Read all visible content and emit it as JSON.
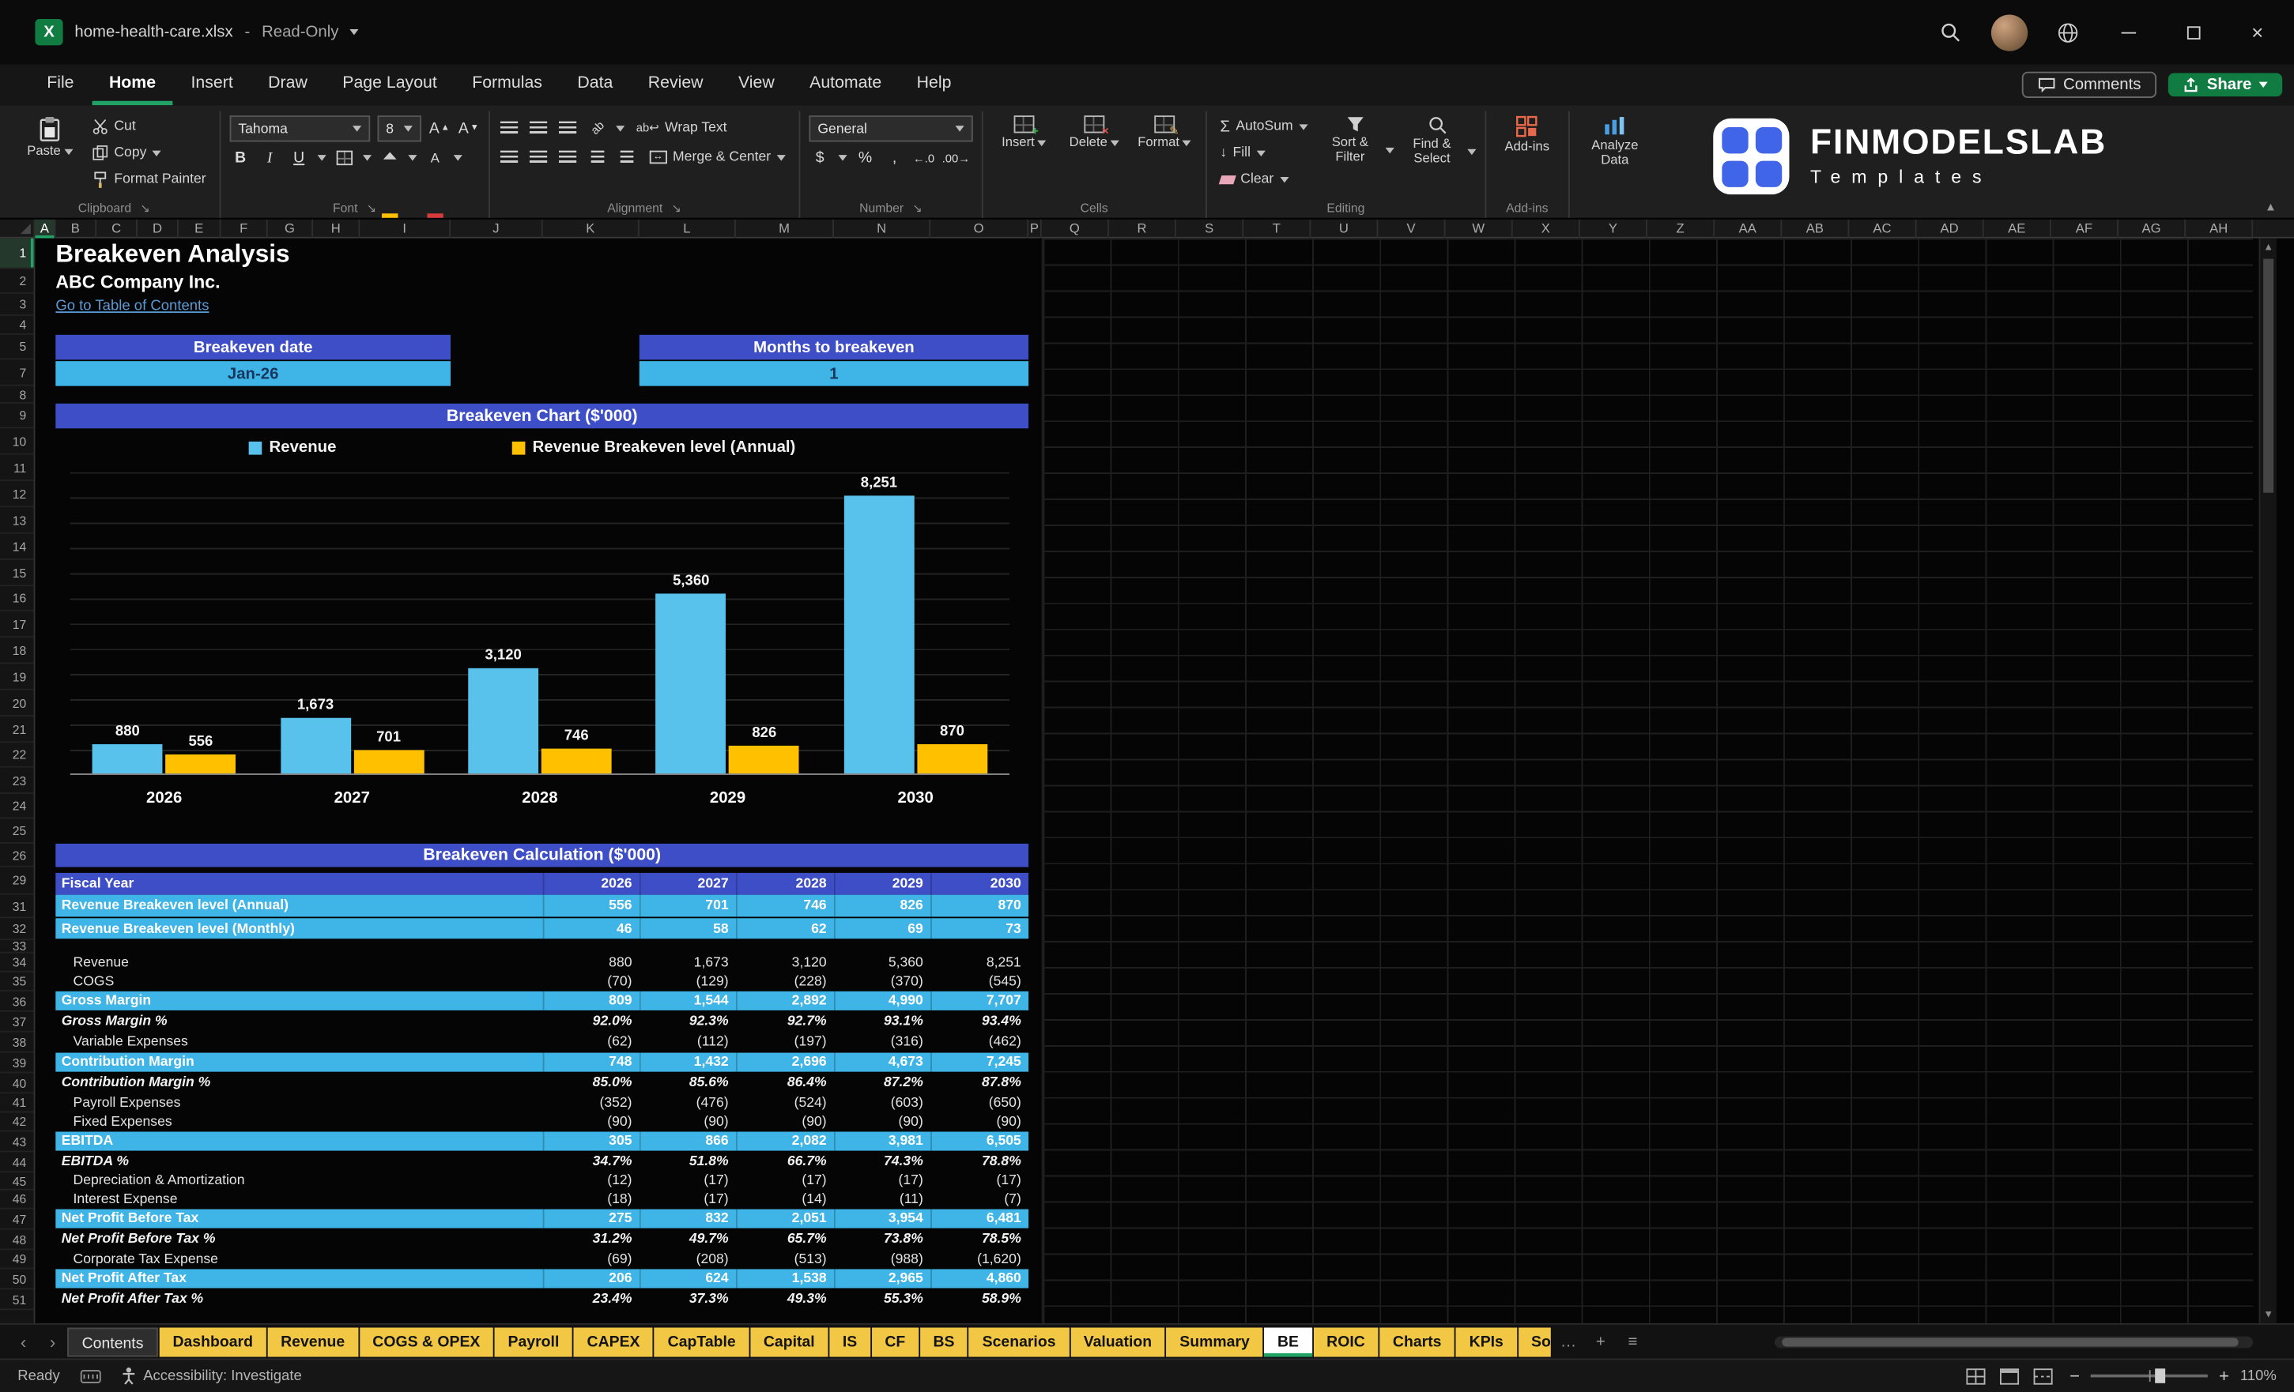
{
  "titlebar": {
    "filename": "home-health-care.xlsx",
    "separator": "-",
    "mode": "Read-Only"
  },
  "menubar": {
    "tabs": [
      "File",
      "Home",
      "Insert",
      "Draw",
      "Page Layout",
      "Formulas",
      "Data",
      "Review",
      "View",
      "Automate",
      "Help"
    ],
    "active_tab": "Home",
    "comments_label": "Comments",
    "share_label": "Share"
  },
  "ribbon": {
    "clipboard": {
      "label": "Clipboard",
      "paste": "Paste",
      "cut": "Cut",
      "copy": "Copy",
      "format_painter": "Format Painter"
    },
    "font": {
      "label": "Font",
      "font_name": "Tahoma",
      "font_size": "8"
    },
    "alignment": {
      "label": "Alignment",
      "wrap_text": "Wrap Text",
      "merge_center": "Merge & Center"
    },
    "number": {
      "label": "Number",
      "format": "General"
    },
    "cells": {
      "label": "Cells",
      "insert": "Insert",
      "delete": "Delete",
      "format": "Format"
    },
    "editing": {
      "label": "Editing",
      "autosum": "AutoSum",
      "fill": "Fill",
      "clear": "Clear",
      "sort_filter": "Sort & Filter",
      "find_select": "Find & Select"
    },
    "addins": {
      "label": "Add-ins",
      "addins": "Add-ins",
      "analyze": "Analyze Data"
    },
    "logo": {
      "brand": "FINMODELSLAB",
      "sub": "Templates"
    }
  },
  "grid": {
    "title": "Breakeven Analysis",
    "company": "ABC Company Inc.",
    "link": "Go to Table of Contents",
    "breakeven_date_label": "Breakeven date",
    "breakeven_date_value": "Jan-26",
    "months_label": "Months to breakeven",
    "months_value": "1",
    "columns": [
      {
        "label": "A",
        "w": 14
      },
      {
        "label": "B",
        "w": 28
      },
      {
        "label": "C",
        "w": 28
      },
      {
        "label": "D",
        "w": 28
      },
      {
        "label": "E",
        "w": 29
      },
      {
        "label": "F",
        "w": 32
      },
      {
        "label": "G",
        "w": 31
      },
      {
        "label": "H",
        "w": 32
      },
      {
        "label": "I",
        "w": 62
      },
      {
        "label": "J",
        "w": 63
      },
      {
        "label": "K",
        "w": 66
      },
      {
        "label": "L",
        "w": 66
      },
      {
        "label": "M",
        "w": 67
      },
      {
        "label": "N",
        "w": 66
      },
      {
        "label": "O",
        "w": 67
      },
      {
        "label": "P",
        "w": 9
      },
      {
        "label": "Q",
        "w": 46
      },
      {
        "label": "R",
        "w": 46
      },
      {
        "label": "S",
        "w": 46
      },
      {
        "label": "T",
        "w": 46
      },
      {
        "label": "U",
        "w": 46
      },
      {
        "label": "V",
        "w": 46
      },
      {
        "label": "W",
        "w": 46
      },
      {
        "label": "X",
        "w": 46
      },
      {
        "label": "Y",
        "w": 46
      },
      {
        "label": "Z",
        "w": 46
      },
      {
        "label": "AA",
        "w": 46
      },
      {
        "label": "AB",
        "w": 46
      },
      {
        "label": "AC",
        "w": 46
      },
      {
        "label": "AD",
        "w": 46
      },
      {
        "label": "AE",
        "w": 46
      },
      {
        "label": "AF",
        "w": 46
      },
      {
        "label": "AG",
        "w": 46
      },
      {
        "label": "AH",
        "w": 46
      }
    ],
    "rows": [
      {
        "n": 1,
        "y": 0,
        "h": 21
      },
      {
        "n": 2,
        "y": 21,
        "h": 17
      },
      {
        "n": 3,
        "y": 38,
        "h": 15
      },
      {
        "n": 4,
        "y": 53,
        "h": 13
      },
      {
        "n": 5,
        "y": 66,
        "h": 17
      },
      {
        "n": 7,
        "y": 83,
        "h": 18
      },
      {
        "n": 8,
        "y": 101,
        "h": 12
      },
      {
        "n": 9,
        "y": 113,
        "h": 17
      },
      {
        "n": 10,
        "y": 130,
        "h": 18
      },
      {
        "n": 11,
        "y": 148,
        "h": 18
      },
      {
        "n": 12,
        "y": 166,
        "h": 18
      },
      {
        "n": 13,
        "y": 184,
        "h": 18
      },
      {
        "n": 14,
        "y": 202,
        "h": 18
      },
      {
        "n": 15,
        "y": 220,
        "h": 18
      },
      {
        "n": 16,
        "y": 238,
        "h": 17
      },
      {
        "n": 17,
        "y": 255,
        "h": 18
      },
      {
        "n": 18,
        "y": 273,
        "h": 18
      },
      {
        "n": 19,
        "y": 291,
        "h": 18
      },
      {
        "n": 20,
        "y": 309,
        "h": 18
      },
      {
        "n": 21,
        "y": 327,
        "h": 18
      },
      {
        "n": 22,
        "y": 345,
        "h": 17
      },
      {
        "n": 23,
        "y": 362,
        "h": 18
      },
      {
        "n": 24,
        "y": 380,
        "h": 17
      },
      {
        "n": 25,
        "y": 397,
        "h": 17
      },
      {
        "n": 26,
        "y": 414,
        "h": 16
      },
      {
        "n": 29,
        "y": 430,
        "h": 19
      },
      {
        "n": 31,
        "y": 449,
        "h": 16
      },
      {
        "n": 32,
        "y": 465,
        "h": 15
      },
      {
        "n": 33,
        "y": 480,
        "h": 9
      },
      {
        "n": 34,
        "y": 489,
        "h": 13
      },
      {
        "n": 35,
        "y": 502,
        "h": 13
      },
      {
        "n": 36,
        "y": 515,
        "h": 14
      },
      {
        "n": 37,
        "y": 529,
        "h": 14
      },
      {
        "n": 38,
        "y": 543,
        "h": 14
      },
      {
        "n": 39,
        "y": 557,
        "h": 14
      },
      {
        "n": 40,
        "y": 571,
        "h": 14
      },
      {
        "n": 41,
        "y": 585,
        "h": 13
      },
      {
        "n": 42,
        "y": 598,
        "h": 13
      },
      {
        "n": 43,
        "y": 611,
        "h": 14
      },
      {
        "n": 44,
        "y": 625,
        "h": 14
      },
      {
        "n": 45,
        "y": 639,
        "h": 12
      },
      {
        "n": 46,
        "y": 651,
        "h": 13
      },
      {
        "n": 47,
        "y": 664,
        "h": 14
      },
      {
        "n": 48,
        "y": 678,
        "h": 14
      },
      {
        "n": 49,
        "y": 692,
        "h": 13
      },
      {
        "n": 50,
        "y": 705,
        "h": 14
      },
      {
        "n": 51,
        "y": 719,
        "h": 14
      }
    ]
  },
  "chart_data": {
    "type": "bar",
    "title": "Breakeven Chart ($'000)",
    "categories": [
      "2026",
      "2027",
      "2028",
      "2029",
      "2030"
    ],
    "series": [
      {
        "name": "Revenue",
        "color": "#58C1EC",
        "values": [
          880,
          1673,
          3120,
          5360,
          8251
        ],
        "labels": [
          "880",
          "1,673",
          "3,120",
          "5,360",
          "8,251"
        ]
      },
      {
        "name": "Revenue Breakeven level (Annual)",
        "color": "#FFC000",
        "values": [
          556,
          701,
          746,
          826,
          870
        ],
        "labels": [
          "556",
          "701",
          "746",
          "826",
          "870"
        ]
      }
    ],
    "ylim": [
      0,
      9000
    ],
    "legend_position": "top",
    "grid": true
  },
  "table": {
    "title": "Breakeven Calculation ($'000)",
    "header": {
      "label": "Fiscal Year",
      "years": [
        "2026",
        "2027",
        "2028",
        "2029",
        "2030"
      ]
    },
    "rows": [
      {
        "label": "Revenue Breakeven level (Annual)",
        "type": "highlight",
        "values": [
          "556",
          "701",
          "746",
          "826",
          "870"
        ]
      },
      {
        "label": "Revenue Breakeven level (Monthly)",
        "type": "highlight",
        "values": [
          "46",
          "58",
          "62",
          "69",
          "73"
        ]
      },
      {
        "label": "",
        "type": "gap",
        "values": [
          "",
          "",
          "",
          "",
          ""
        ]
      },
      {
        "label": "Revenue",
        "type": "plain",
        "values": [
          "880",
          "1,673",
          "3,120",
          "5,360",
          "8,251"
        ]
      },
      {
        "label": "COGS",
        "type": "plain",
        "values": [
          "(70)",
          "(129)",
          "(228)",
          "(370)",
          "(545)"
        ]
      },
      {
        "label": "Gross Margin",
        "type": "highlight",
        "values": [
          "809",
          "1,544",
          "2,892",
          "4,990",
          "7,707"
        ]
      },
      {
        "label": "Gross Margin %",
        "type": "pct",
        "values": [
          "92.0%",
          "92.3%",
          "92.7%",
          "93.1%",
          "93.4%"
        ]
      },
      {
        "label": "Variable Expenses",
        "type": "plain",
        "values": [
          "(62)",
          "(112)",
          "(197)",
          "(316)",
          "(462)"
        ]
      },
      {
        "label": "Contribution Margin",
        "type": "highlight",
        "values": [
          "748",
          "1,432",
          "2,696",
          "4,673",
          "7,245"
        ]
      },
      {
        "label": "Contribution Margin %",
        "type": "pct",
        "values": [
          "85.0%",
          "85.6%",
          "86.4%",
          "87.2%",
          "87.8%"
        ]
      },
      {
        "label": "Payroll Expenses",
        "type": "plain",
        "values": [
          "(352)",
          "(476)",
          "(524)",
          "(603)",
          "(650)"
        ]
      },
      {
        "label": "Fixed Expenses",
        "type": "plain",
        "values": [
          "(90)",
          "(90)",
          "(90)",
          "(90)",
          "(90)"
        ]
      },
      {
        "label": "EBITDA",
        "type": "highlight",
        "values": [
          "305",
          "866",
          "2,082",
          "3,981",
          "6,505"
        ]
      },
      {
        "label": "EBITDA %",
        "type": "pct",
        "values": [
          "34.7%",
          "51.8%",
          "66.7%",
          "74.3%",
          "78.8%"
        ]
      },
      {
        "label": "Depreciation & Amortization",
        "type": "plain",
        "values": [
          "(12)",
          "(17)",
          "(17)",
          "(17)",
          "(17)"
        ]
      },
      {
        "label": "Interest Expense",
        "type": "plain",
        "values": [
          "(18)",
          "(17)",
          "(14)",
          "(11)",
          "(7)"
        ]
      },
      {
        "label": "Net Profit Before Tax",
        "type": "highlight",
        "values": [
          "275",
          "832",
          "2,051",
          "3,954",
          "6,481"
        ]
      },
      {
        "label": "Net Profit Before Tax %",
        "type": "pct",
        "values": [
          "31.2%",
          "49.7%",
          "65.7%",
          "73.8%",
          "78.5%"
        ]
      },
      {
        "label": "Corporate Tax Expense",
        "type": "plain",
        "values": [
          "(69)",
          "(208)",
          "(513)",
          "(988)",
          "(1,620)"
        ]
      },
      {
        "label": "Net Profit After Tax",
        "type": "highlight",
        "values": [
          "206",
          "624",
          "1,538",
          "2,965",
          "4,860"
        ]
      },
      {
        "label": "Net Profit After Tax %",
        "type": "pct",
        "values": [
          "23.4%",
          "37.3%",
          "49.3%",
          "55.3%",
          "58.9%"
        ]
      }
    ]
  },
  "sheet_tabs": {
    "tabs": [
      {
        "label": "Contents",
        "style": "dark"
      },
      {
        "label": "Dashboard",
        "style": "yellow"
      },
      {
        "label": "Revenue",
        "style": "yellow"
      },
      {
        "label": "COGS & OPEX",
        "style": "yellow"
      },
      {
        "label": "Payroll",
        "style": "yellow"
      },
      {
        "label": "CAPEX",
        "style": "yellow"
      },
      {
        "label": "CapTable",
        "style": "yellow"
      },
      {
        "label": "Capital",
        "style": "yellow"
      },
      {
        "label": "IS",
        "style": "yellow"
      },
      {
        "label": "CF",
        "style": "yellow"
      },
      {
        "label": "BS",
        "style": "yellow"
      },
      {
        "label": "Scenarios",
        "style": "yellow"
      },
      {
        "label": "Valuation",
        "style": "yellow"
      },
      {
        "label": "Summary",
        "style": "yellow"
      },
      {
        "label": "BE",
        "style": "active"
      },
      {
        "label": "ROIC",
        "style": "yellow"
      },
      {
        "label": "Charts",
        "style": "yellow"
      },
      {
        "label": "KPIs",
        "style": "yellow"
      },
      {
        "label": "So",
        "style": "yellow",
        "truncated": true
      }
    ]
  },
  "statusbar": {
    "ready": "Ready",
    "accessibility": "Accessibility: Investigate",
    "zoom": "110%"
  },
  "colors": {
    "header_blue": "#3E4EC6",
    "row_cyan": "#3FB4E6",
    "bar_blue": "#58C1EC",
    "bar_gold": "#FFC000",
    "tab_yellow": "#F2C744",
    "share_green": "#107C41",
    "accent_green": "#21A366",
    "link_blue": "#5B9BD5"
  }
}
